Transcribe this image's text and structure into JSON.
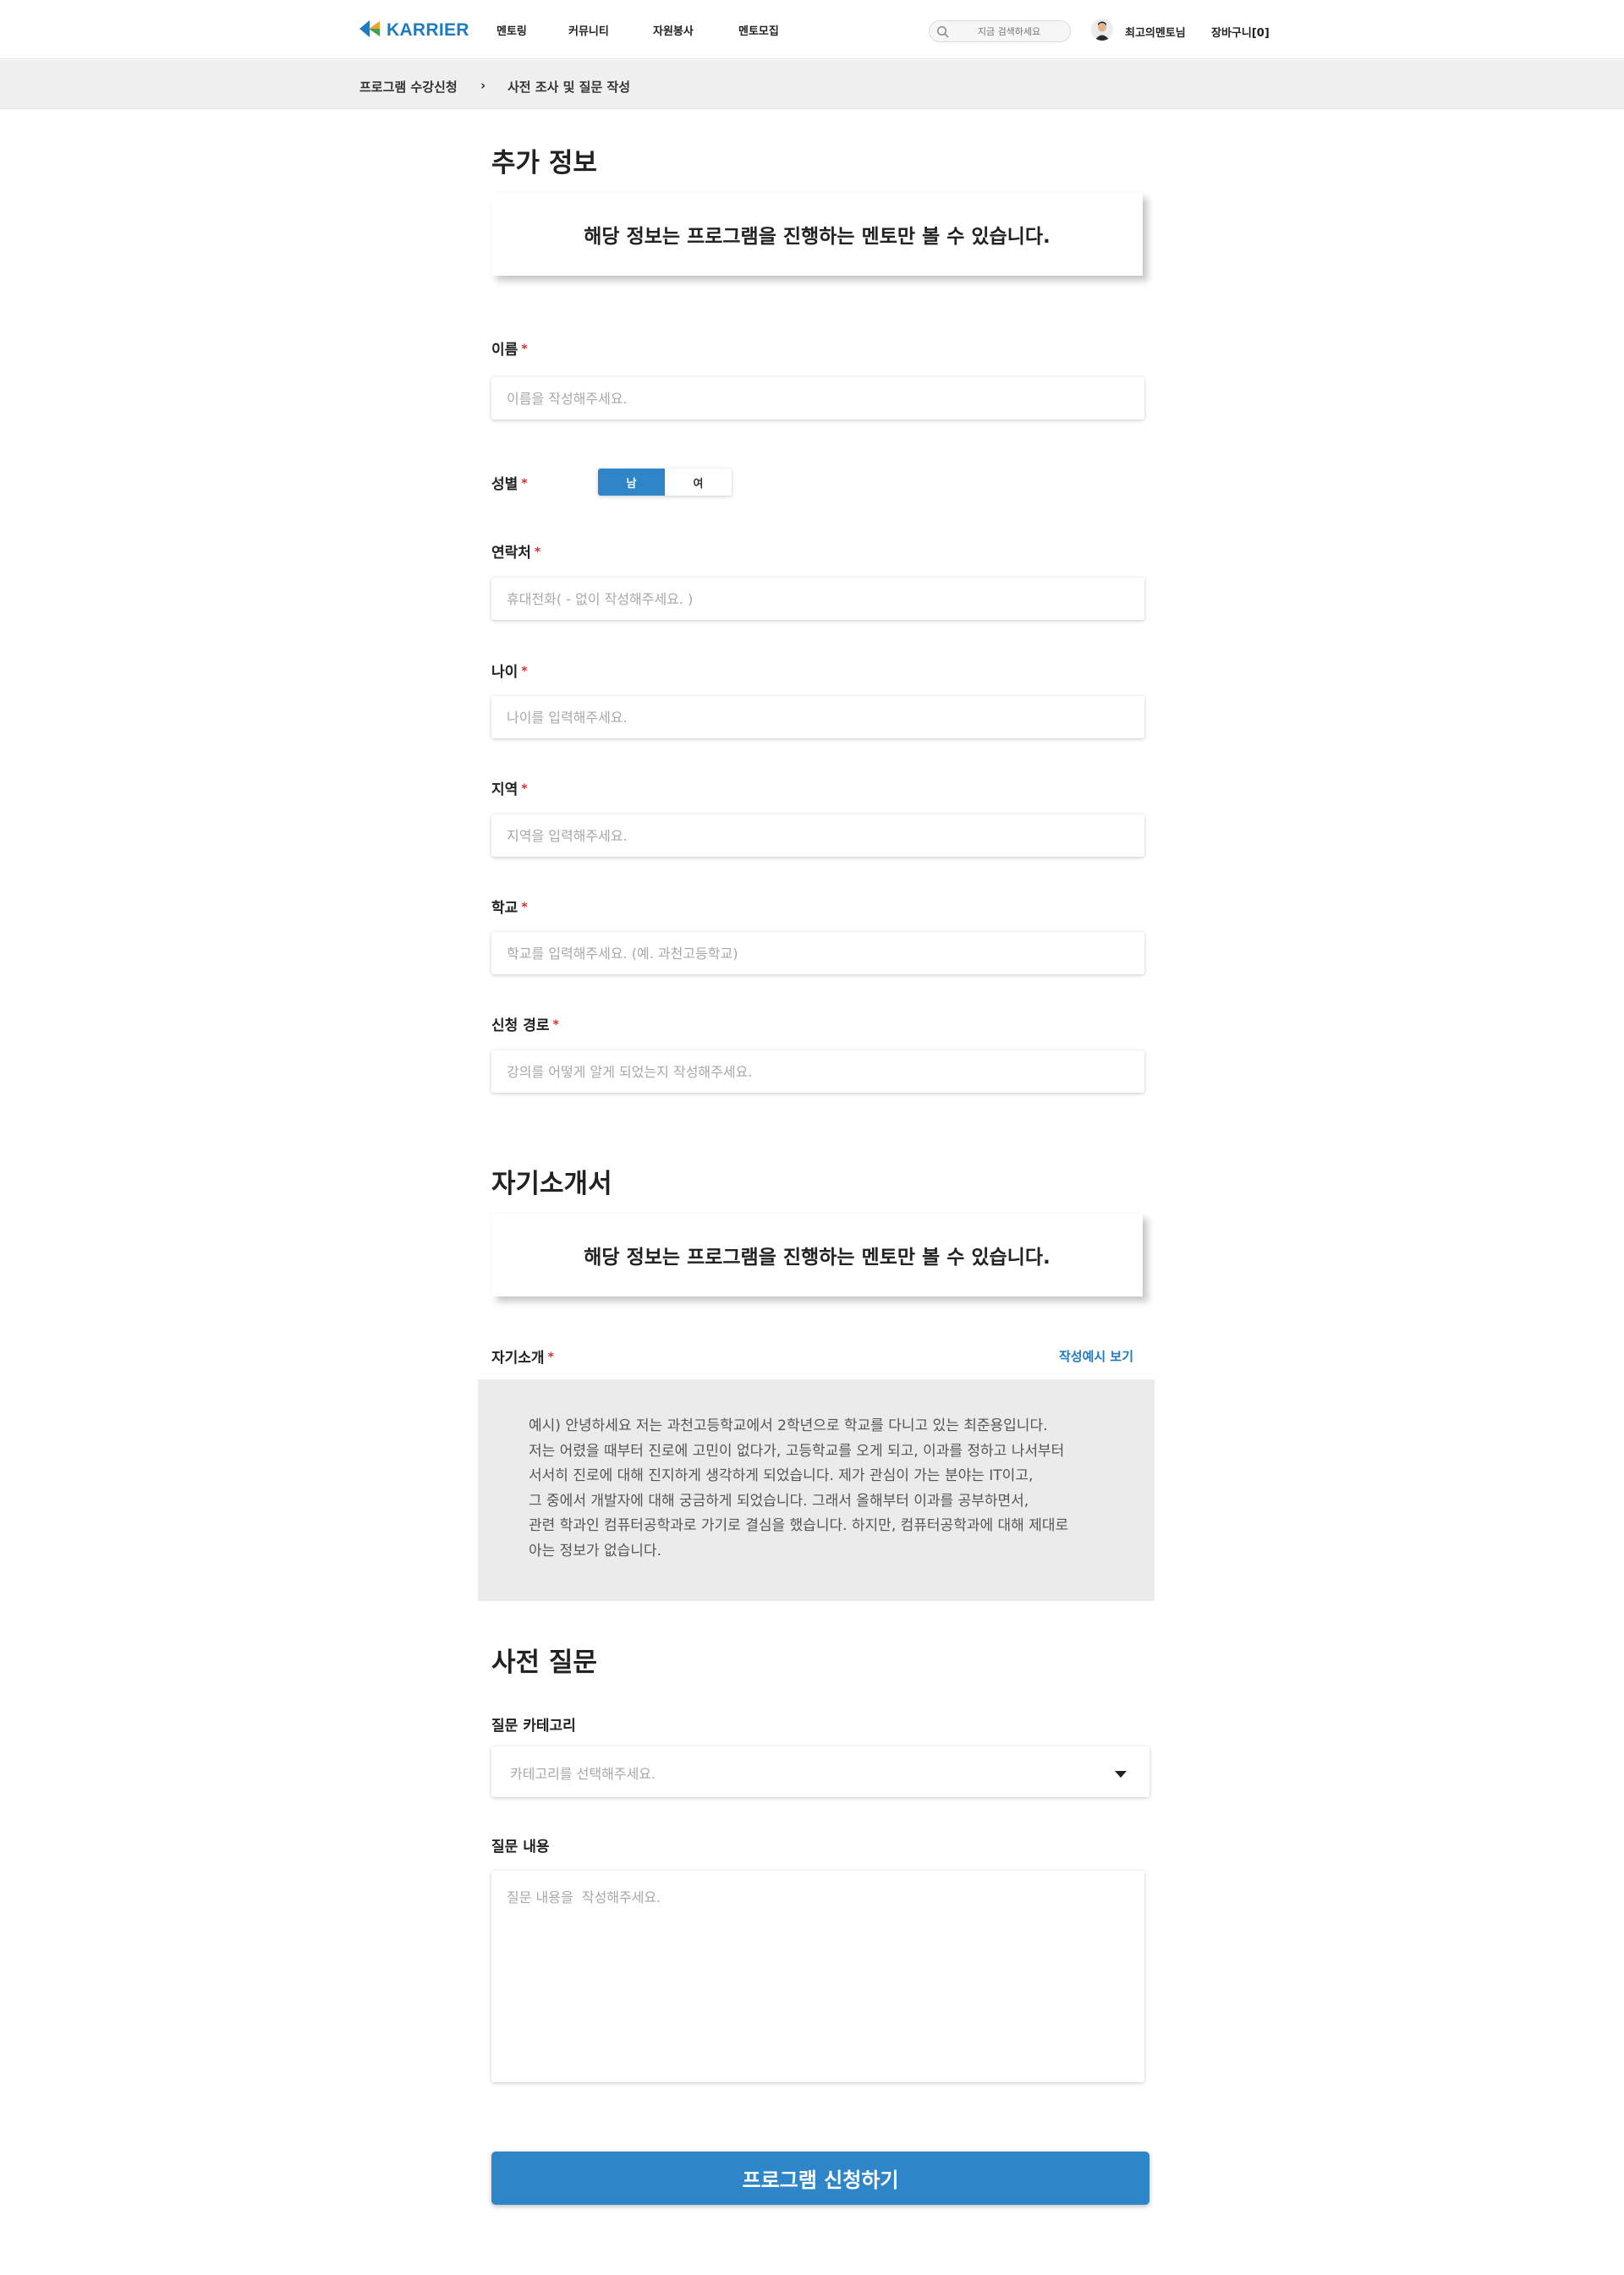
{
  "header": {
    "logo_text": "KARRIER",
    "nav": [
      "멘토링",
      "커뮤니티",
      "자원봉사",
      "멘토모집"
    ],
    "search_placeholder": "지금 검색하세요",
    "user_name": "최고의멘토님",
    "cart_label": "장바구니[0]",
    "accent_color": "#1f7bc1"
  },
  "breadcrumb": {
    "items": [
      "프로그램 수강신청",
      "사전 조사 및 질문 작성"
    ],
    "separator": "›"
  },
  "extra_info": {
    "title": "추가 정보",
    "notice": "해당 정보는 프로그램을 진행하는 멘토만 볼 수 있습니다.",
    "required_mark": "*",
    "name": {
      "label": "이름",
      "placeholder": "이름을 작성해주세요."
    },
    "gender": {
      "label": "성별",
      "options": [
        "남",
        "여"
      ],
      "selected": "남"
    },
    "phone": {
      "label": "연락처",
      "placeholder": "휴대전화( - 없이 작성해주세요. )"
    },
    "age": {
      "label": "나이",
      "placeholder": "나이를 입력해주세요."
    },
    "region": {
      "label": "지역",
      "placeholder": "지역을 입력해주세요."
    },
    "school": {
      "label": "학교",
      "placeholder": "학교를 입력해주세요. (예. 과천고등학교)"
    },
    "referral": {
      "label": "신청 경로",
      "placeholder": "강의를 어떻게 알게 되었는지 작성해주세요."
    }
  },
  "self_intro": {
    "title": "자기소개서",
    "notice": "해당 정보는 프로그램을 진행하는 멘토만 볼 수 있습니다.",
    "label": "자기소개",
    "example_link": "작성예시 보기",
    "example_lines": [
      "예시) 안녕하세요 저는 과천고등학교에서 2학년으로 학교를 다니고 있는 최준용입니다.",
      "저는 어렸을 때부터 진로에 고민이 없다가, 고등학교를 오게 되고, 이과를 정하고 나서부터",
      "서서히 진로에 대해 진지하게 생각하게 되었습니다. 제가 관심이 가는 분야는 IT이고,",
      "그 중에서 개발자에 대해 궁금하게 되었습니다. 그래서 올해부터 이과를 공부하면서,",
      "관련 학과인 컴퓨터공학과로 가기로 결심을 했습니다. 하지만, 컴퓨터공학과에 대해 제대로",
      "아는 정보가 없습니다."
    ]
  },
  "pre_question": {
    "title": "사전 질문",
    "category_label": "질문 카테고리",
    "category_placeholder": "카테고리를 선택해주세요.",
    "content_label": "질문 내용",
    "content_placeholder": "질문 내용을  작성해주세요."
  },
  "submit_label": "프로그램 신청하기",
  "icons": {
    "logo": "karrier-logo-icon",
    "search": "search-icon",
    "avatar": "user-avatar",
    "dropdown": "caret-down-icon"
  }
}
